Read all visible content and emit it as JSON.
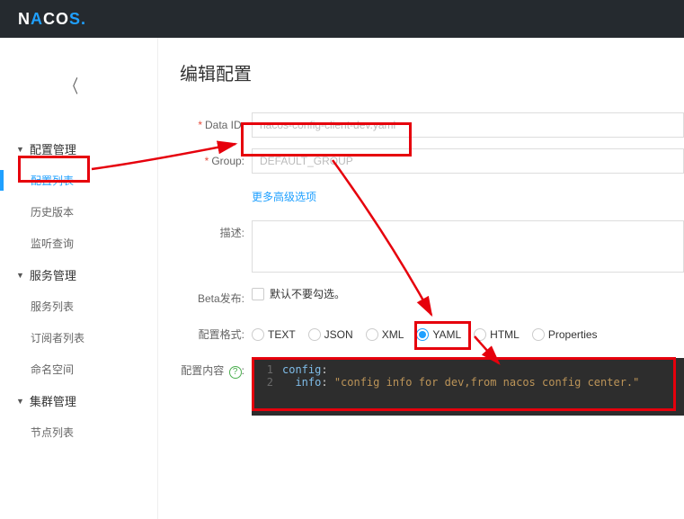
{
  "logo": {
    "part1": "N",
    "part2": "A",
    "part3": "CO",
    "part4": "S",
    "dot": "."
  },
  "sidebar": {
    "groups": [
      {
        "label": "配置管理",
        "items": [
          {
            "label": "配置列表",
            "active": true
          },
          {
            "label": "历史版本"
          },
          {
            "label": "监听查询"
          }
        ]
      },
      {
        "label": "服务管理",
        "items": [
          {
            "label": "服务列表"
          },
          {
            "label": "订阅者列表"
          }
        ]
      },
      {
        "label": "命名空间",
        "items": []
      },
      {
        "label": "集群管理",
        "items": [
          {
            "label": "节点列表"
          }
        ]
      }
    ]
  },
  "page": {
    "title": "编辑配置",
    "labels": {
      "dataId": "Data ID:",
      "group": "Group:",
      "moreOptions": "更多高级选项",
      "desc": "描述:",
      "beta": "Beta发布:",
      "betaCheckbox": "默认不要勾选。",
      "format": "配置格式:",
      "content": "配置内容",
      "help": "?"
    },
    "values": {
      "dataId": "nacos-config-client-dev.yaml",
      "group": "DEFAULT_GROUP",
      "desc": ""
    },
    "formats": [
      "TEXT",
      "JSON",
      "XML",
      "YAML",
      "HTML",
      "Properties"
    ],
    "formatSelected": "YAML",
    "editor": {
      "lines": [
        {
          "n": "1",
          "key": "config",
          "colon": ":"
        },
        {
          "n": "2",
          "indent": "  ",
          "key": "info",
          "colon": ": ",
          "str": "\"config info for dev,from nacos config center.\""
        }
      ]
    }
  }
}
